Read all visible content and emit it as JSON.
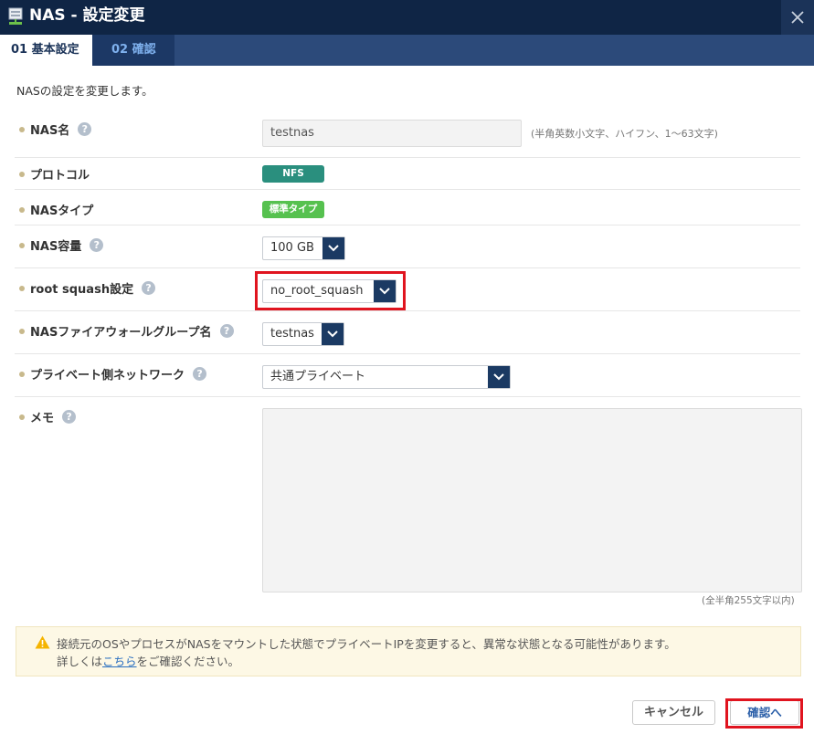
{
  "window": {
    "title": "NAS - 設定変更",
    "close_icon": "close-icon"
  },
  "tabs": [
    {
      "label": "01 基本設定",
      "active": true
    },
    {
      "label": "02 確認",
      "active": false
    }
  ],
  "intro": "NASの設定を変更します。",
  "fields": {
    "nas_name": {
      "label": "NAS名",
      "value": "testnas",
      "hint": "(半角英数小文字、ハイフン、1〜63文字)"
    },
    "protocol": {
      "label": "プロトコル",
      "value": "NFS"
    },
    "nas_type": {
      "label": "NASタイプ",
      "value": "標準タイプ"
    },
    "capacity": {
      "label": "NAS容量",
      "value": "100 GB"
    },
    "root_squash": {
      "label": "root squash設定",
      "value": "no_root_squash"
    },
    "firewall_group": {
      "label": "NASファイアウォールグループ名",
      "value": "testnas"
    },
    "private_network": {
      "label": "プライベート側ネットワーク",
      "value": "共通プライベート"
    },
    "memo": {
      "label": "メモ",
      "value": "",
      "hint": "(全半角255文字以内)"
    }
  },
  "warning": {
    "line1": "接続元のOSやプロセスがNASをマウントした状態でプライベートIPを変更すると、異常な状態となる可能性があります。",
    "line2_prefix": "詳しくは",
    "link": "こちら",
    "line2_suffix": "をご確認ください。"
  },
  "buttons": {
    "cancel": "キャンセル",
    "confirm": "確認へ"
  },
  "colors": {
    "header": "#0f2545",
    "tabbar": "#2c4a7a",
    "highlight": "#e0141f",
    "badge_nfs": "#2a8f7e",
    "badge_type": "#56c14f"
  }
}
